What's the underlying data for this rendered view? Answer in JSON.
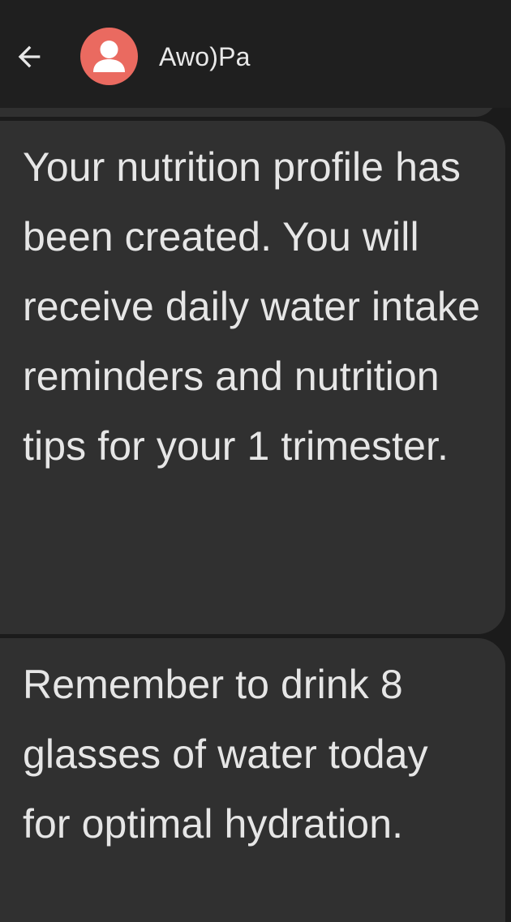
{
  "header": {
    "back_icon": "arrow-left-icon",
    "avatar_icon": "person-icon",
    "contact_name": "Awo)Pa",
    "avatar_color": "#ea6a60"
  },
  "messages": [
    {
      "text": "Your nutrition profile has been created. You will receive daily water intake reminders and nutrition tips for your 1 trimester."
    },
    {
      "text": "Remember to drink 8 glasses of water today for optimal hydration."
    }
  ],
  "colors": {
    "background": "#1b1b1b",
    "app_bar": "#1f1f1f",
    "bubble": "#303030",
    "text": "#e6e6e6"
  }
}
